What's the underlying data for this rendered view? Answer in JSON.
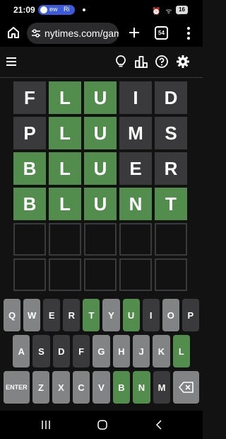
{
  "status_bar": {
    "time": "21:09",
    "notification_left": "ew",
    "notification_right": "Ri",
    "battery": "16"
  },
  "browser": {
    "url": "nytimes.com/gam",
    "tab_count": "54"
  },
  "board": [
    [
      {
        "l": "F",
        "s": "absent"
      },
      {
        "l": "L",
        "s": "correct"
      },
      {
        "l": "U",
        "s": "correct"
      },
      {
        "l": "I",
        "s": "absent"
      },
      {
        "l": "D",
        "s": "absent"
      }
    ],
    [
      {
        "l": "P",
        "s": "absent"
      },
      {
        "l": "L",
        "s": "correct"
      },
      {
        "l": "U",
        "s": "correct"
      },
      {
        "l": "M",
        "s": "absent"
      },
      {
        "l": "S",
        "s": "absent"
      }
    ],
    [
      {
        "l": "B",
        "s": "correct"
      },
      {
        "l": "L",
        "s": "correct"
      },
      {
        "l": "U",
        "s": "correct"
      },
      {
        "l": "E",
        "s": "absent"
      },
      {
        "l": "R",
        "s": "absent"
      }
    ],
    [
      {
        "l": "B",
        "s": "correct"
      },
      {
        "l": "L",
        "s": "correct"
      },
      {
        "l": "U",
        "s": "correct"
      },
      {
        "l": "N",
        "s": "correct"
      },
      {
        "l": "T",
        "s": "correct"
      }
    ],
    [
      {
        "l": "",
        "s": "empty"
      },
      {
        "l": "",
        "s": "empty"
      },
      {
        "l": "",
        "s": "empty"
      },
      {
        "l": "",
        "s": "empty"
      },
      {
        "l": "",
        "s": "empty"
      }
    ],
    [
      {
        "l": "",
        "s": "empty"
      },
      {
        "l": "",
        "s": "empty"
      },
      {
        "l": "",
        "s": "empty"
      },
      {
        "l": "",
        "s": "empty"
      },
      {
        "l": "",
        "s": "empty"
      }
    ]
  ],
  "keyboard": [
    [
      {
        "k": "Q",
        "s": "unused"
      },
      {
        "k": "W",
        "s": "unused"
      },
      {
        "k": "E",
        "s": "absent"
      },
      {
        "k": "R",
        "s": "absent"
      },
      {
        "k": "T",
        "s": "correct"
      },
      {
        "k": "Y",
        "s": "unused"
      },
      {
        "k": "U",
        "s": "correct"
      },
      {
        "k": "I",
        "s": "absent"
      },
      {
        "k": "O",
        "s": "unused"
      },
      {
        "k": "P",
        "s": "absent"
      }
    ],
    [
      {
        "k": "A",
        "s": "unused"
      },
      {
        "k": "S",
        "s": "absent"
      },
      {
        "k": "D",
        "s": "absent"
      },
      {
        "k": "F",
        "s": "absent"
      },
      {
        "k": "G",
        "s": "unused"
      },
      {
        "k": "H",
        "s": "unused"
      },
      {
        "k": "J",
        "s": "unused"
      },
      {
        "k": "K",
        "s": "unused"
      },
      {
        "k": "L",
        "s": "correct"
      }
    ],
    [
      {
        "k": "ENTER",
        "s": "unused",
        "wide": true
      },
      {
        "k": "Z",
        "s": "unused"
      },
      {
        "k": "X",
        "s": "unused"
      },
      {
        "k": "C",
        "s": "unused"
      },
      {
        "k": "V",
        "s": "unused"
      },
      {
        "k": "B",
        "s": "correct"
      },
      {
        "k": "N",
        "s": "correct"
      },
      {
        "k": "M",
        "s": "absent"
      },
      {
        "k": "",
        "s": "unused",
        "wide": true,
        "icon": "backspace-icon"
      }
    ]
  ],
  "colors": {
    "correct": "#538d4e",
    "absent": "#3a3a3c",
    "unused": "#818384",
    "background": "#121213"
  }
}
